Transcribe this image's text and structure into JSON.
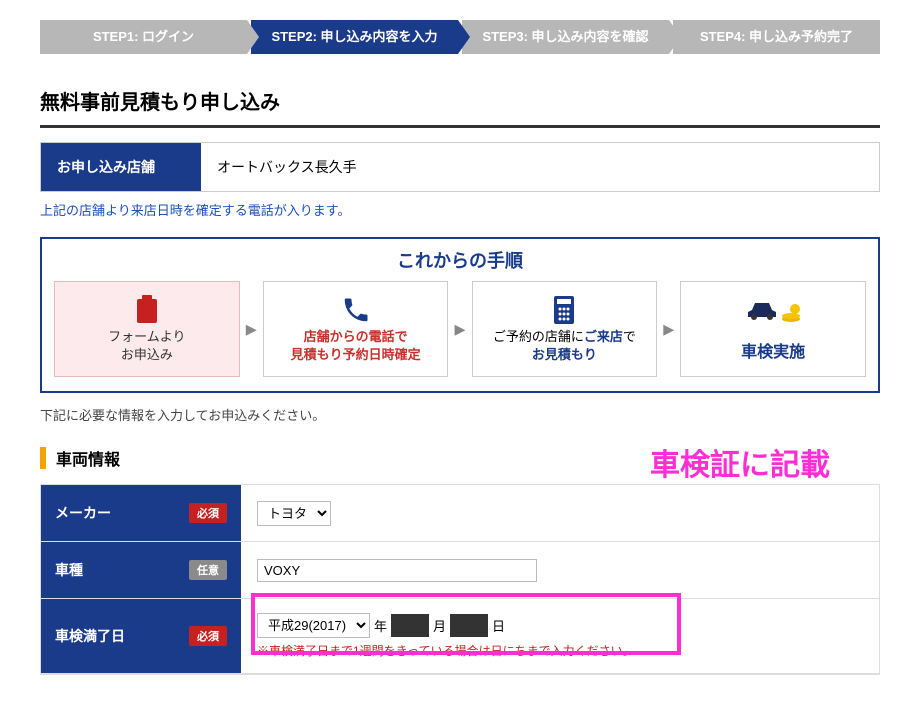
{
  "steps": [
    {
      "label": "STEP1: ログイン"
    },
    {
      "label": "STEP2: 申し込み内容を入力",
      "active": true
    },
    {
      "label": "STEP3: 申し込み内容を確認"
    },
    {
      "label": "STEP4: 申し込み予約完了"
    }
  ],
  "title": "無料事前見積もり申し込み",
  "store": {
    "label": "お申し込み店舗",
    "value": "オートバックス長久手",
    "note": "上記の店舗より来店日時を確定する電話が入ります。"
  },
  "flow": {
    "title": "これからの手順",
    "cards": [
      {
        "line1": "フォームより",
        "line2": "お申込み"
      },
      {
        "line1": "店舗からの電話で",
        "line2": "見積もり予約日時確定"
      },
      {
        "pre1": "ご予約の店舗に",
        "strong1": "ご来店",
        "post1": "で",
        "line2": "お見積もり"
      },
      {
        "line1": "車検実施"
      }
    ]
  },
  "instruct": "下記に必要な情報を入力してお申込みください。",
  "section_vehicle": "車両情報",
  "form": {
    "maker": {
      "label": "メーカー",
      "badge": "必須",
      "value": "トヨタ"
    },
    "model": {
      "label": "車種",
      "badge": "任意",
      "value": "VOXY"
    },
    "expiry": {
      "label": "車検満了日",
      "badge": "必須",
      "era": "平成29(2017)",
      "year_suffix": "年",
      "month_suffix": "月",
      "day_suffix": "日",
      "note": "※車検満了日まで1週間をきっている場合は日にちまで入力ください。"
    }
  },
  "annotation": "車検証に記載"
}
